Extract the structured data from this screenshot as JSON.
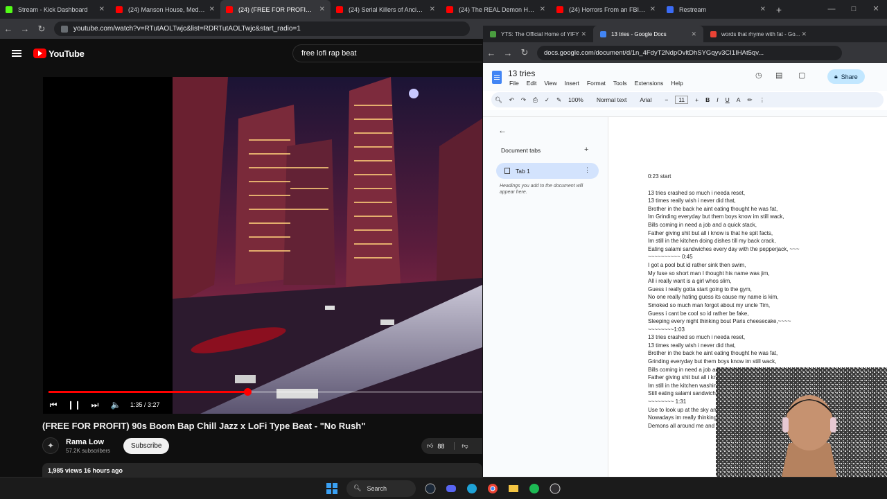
{
  "browser_tabs": [
    {
      "title": "Stream - Kick Dashboard",
      "color": "#53fc18"
    },
    {
      "title": "(24) Manson House, Medical E...",
      "color": "#ff0000"
    },
    {
      "title": "(24) (FREE FOR PROFIT) 90s",
      "color": "#ff0000",
      "active": true
    },
    {
      "title": "(24) Serial Killers of Ancient Eg...",
      "color": "#ff0000"
    },
    {
      "title": "(24) The REAL Demon Hierarch...",
      "color": "#ff0000"
    },
    {
      "title": "(24) Horrors From an FBI Datab...",
      "color": "#ff0000"
    },
    {
      "title": "Restream",
      "color": "#3b6cf6"
    }
  ],
  "url": "youtube.com/watch?v=RTutAOLTwjc&list=RDRTutAOLTwjc&start_radio=1",
  "youtube": {
    "logo_text": "YouTube",
    "search_query": "free lofi rap beat",
    "time": "1:35 / 3:27",
    "progress_fraction": 0.459,
    "video_title": "(FREE FOR PROFIT) 90s Boom Bap Chill Jazz x LoFi Type Beat - \"No Rush\"",
    "channel_name": "Rama Low",
    "subscribers": "57.2K subscribers",
    "subscribe_label": "Subscribe",
    "likes": "88",
    "views_date": "1,985 views  16 hours ago"
  },
  "docs_window": {
    "tabs": [
      {
        "title": "YTS: The Official Home of YIFY",
        "color": "#4a9d3f"
      },
      {
        "title": "13 tries - Google Docs",
        "color": "#4285f4",
        "active": true
      },
      {
        "title": "words that rhyme with fat - Go...",
        "color": "#ea4335"
      }
    ],
    "url": "docs.google.com/document/d/1n_4FdyT2NdpOvltDhSYGqyv3CI1IHAt5qv...",
    "doc_title": "13 tries",
    "menu": [
      "File",
      "Edit",
      "View",
      "Insert",
      "Format",
      "Tools",
      "Extensions",
      "Help"
    ],
    "share_label": "Share",
    "toolbar": {
      "zoom": "100%",
      "style": "Normal text",
      "font": "Arial",
      "size": "11"
    },
    "outline": {
      "heading": "Document tabs",
      "tab_label": "Tab 1",
      "hint": "Headings you add to the document will appear here."
    },
    "lyrics": [
      "0:23 start",
      "",
      "13 tries crashed so much i needa reset,",
      "13 times really wish i never did that,",
      "Brother in the back he aint eating thought he was fat,",
      "Im Grinding everyday but them boys know im still wack,",
      "Bills coming in need a job and a quick stack,",
      "Father giving shit but all i know is that he spit facts,",
      "Im still in the kitchen doing dishes till my back crack,",
      "Eating salami sandwiches every day with the pepperjack, ~~~",
      "~~~~~~~~~~ 0:45",
      "I got a pool but id rather sink then swim,",
      "My fuse so short man I thought his name was jim,",
      "All i really want is a girl whos slim,",
      "Guess i really gotta start going to the gym,",
      "No one really hating guess its cause my name is kim,",
      "Smoked so much man forgot about my uncle Tim,",
      "Guess i cant be cool so id rather be fake,",
      "Sleeping every night thinking bout Paris cheesecake,~~~~",
      "~~~~~~~~1:03",
      "13 tries crashed so much i needa reset,",
      "13 times really wish i never did that,",
      "Brother in the back he aint eating thought he was fat,",
      "Grinding everyday but them boys know im still wack,",
      "Bills coming in need a job and a quick stack,",
      "Father giving shit but all i know is that he spit facts,",
      "Im still in the kitchen washing dishes till my back crack,",
      "Still eating salami sandwiches everyday with the pepperjack,",
      "~~~~~~~~ 1:31",
      "Use to look up at the sky and dreamed that i could fly,",
      "Nowadays im really thinking of the easiest fall,",
      "Demons all around me and it seems they just wanna claim"
    ]
  },
  "taskbar": {
    "search_label": "Search"
  }
}
